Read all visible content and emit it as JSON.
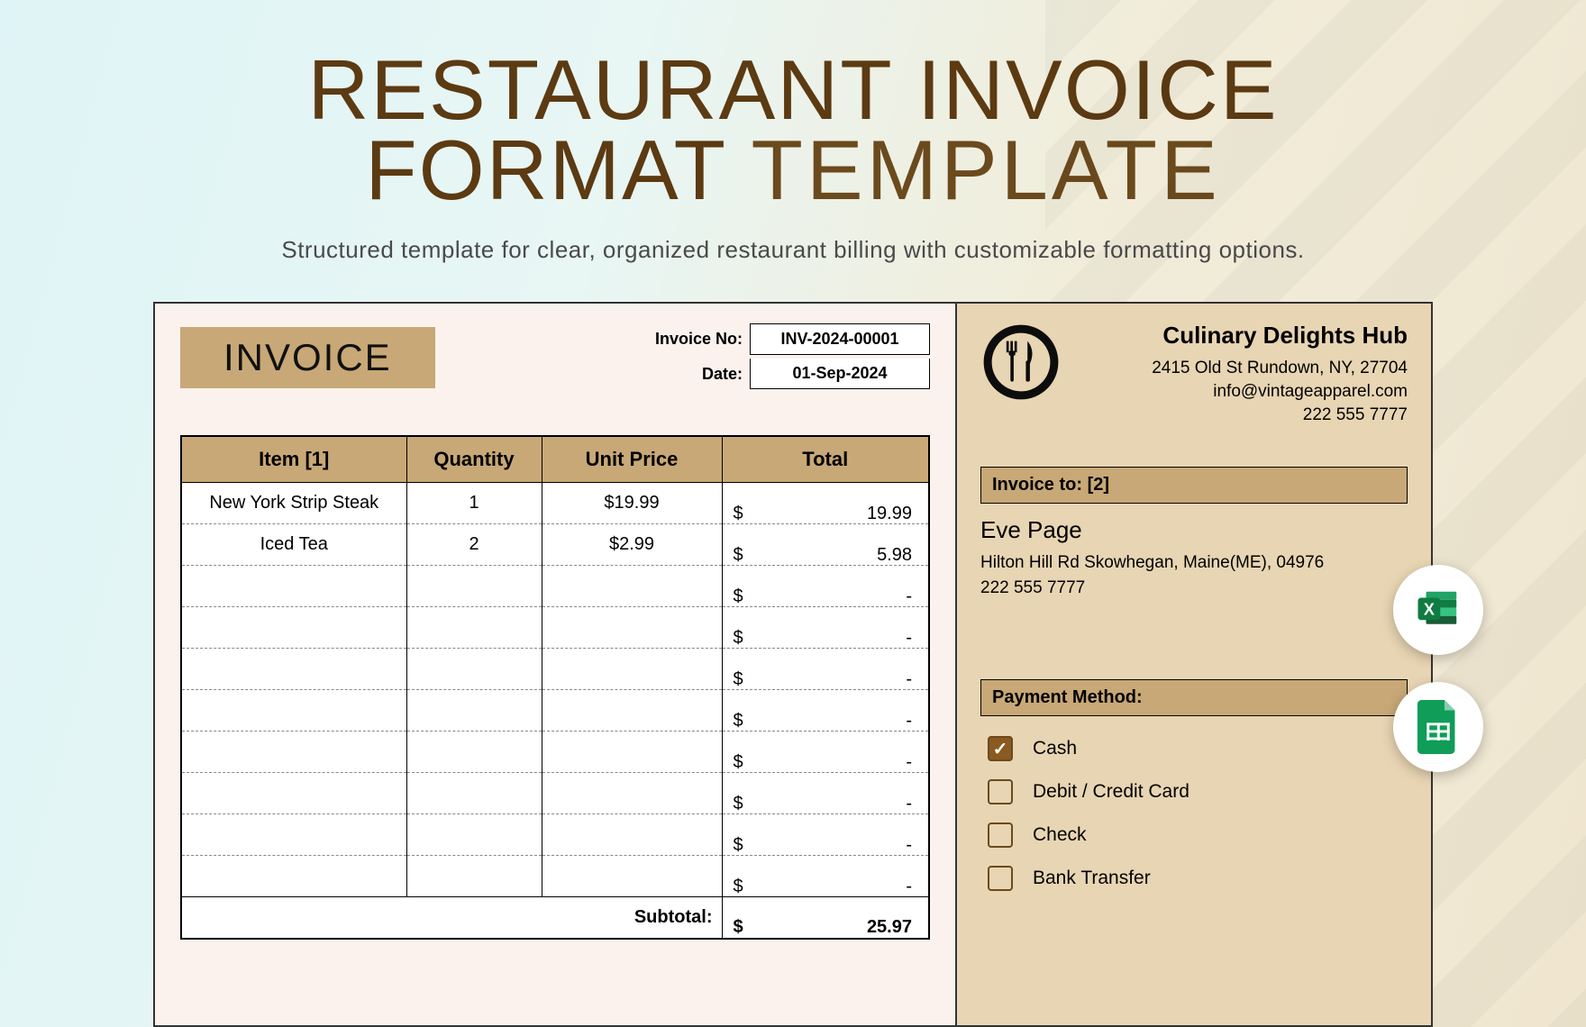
{
  "hero": {
    "title_line1": "RESTAURANT INVOICE",
    "title_line2_bold": "FORMAT",
    "title_line2_thin": "TEMPLATE",
    "subtitle": "Structured template for clear, organized restaurant billing with customizable formatting options."
  },
  "invoice": {
    "badge": "INVOICE",
    "meta": {
      "no_label": "Invoice No:",
      "no_value": "INV-2024-00001",
      "date_label": "Date:",
      "date_value": "01-Sep-2024"
    },
    "columns": {
      "item": "Item [1]",
      "qty": "Quantity",
      "unit": "Unit Price",
      "total": "Total"
    },
    "rows": [
      {
        "item": "New York Strip Steak",
        "qty": "1",
        "unit": "$19.99",
        "total": "19.99"
      },
      {
        "item": "Iced Tea",
        "qty": "2",
        "unit": "$2.99",
        "total": "5.98"
      },
      {
        "item": "",
        "qty": "",
        "unit": "",
        "total": "-"
      },
      {
        "item": "",
        "qty": "",
        "unit": "",
        "total": "-"
      },
      {
        "item": "",
        "qty": "",
        "unit": "",
        "total": "-"
      },
      {
        "item": "",
        "qty": "",
        "unit": "",
        "total": "-"
      },
      {
        "item": "",
        "qty": "",
        "unit": "",
        "total": "-"
      },
      {
        "item": "",
        "qty": "",
        "unit": "",
        "total": "-"
      },
      {
        "item": "",
        "qty": "",
        "unit": "",
        "total": "-"
      },
      {
        "item": "",
        "qty": "",
        "unit": "",
        "total": "-"
      }
    ],
    "subtotal_label": "Subtotal:",
    "subtotal_value": "25.97",
    "currency": "$"
  },
  "business": {
    "name": "Culinary Delights Hub",
    "addr": "2415 Old St Rundown, NY, 27704",
    "email": "info@vintageapparel.com",
    "phone": "222 555 7777"
  },
  "invoice_to": {
    "heading": "Invoice to: [2]",
    "name": "Eve Page",
    "addr": "Hilton Hill Rd Skowhegan, Maine(ME), 04976",
    "phone": "222 555 7777"
  },
  "payment": {
    "heading": "Payment Method:",
    "options": [
      {
        "label": "Cash",
        "checked": true
      },
      {
        "label": "Debit / Credit Card",
        "checked": false
      },
      {
        "label": "Check",
        "checked": false
      },
      {
        "label": "Bank Transfer",
        "checked": false
      }
    ]
  },
  "fabs": {
    "excel": "excel-icon",
    "sheets": "google-sheets-icon"
  }
}
